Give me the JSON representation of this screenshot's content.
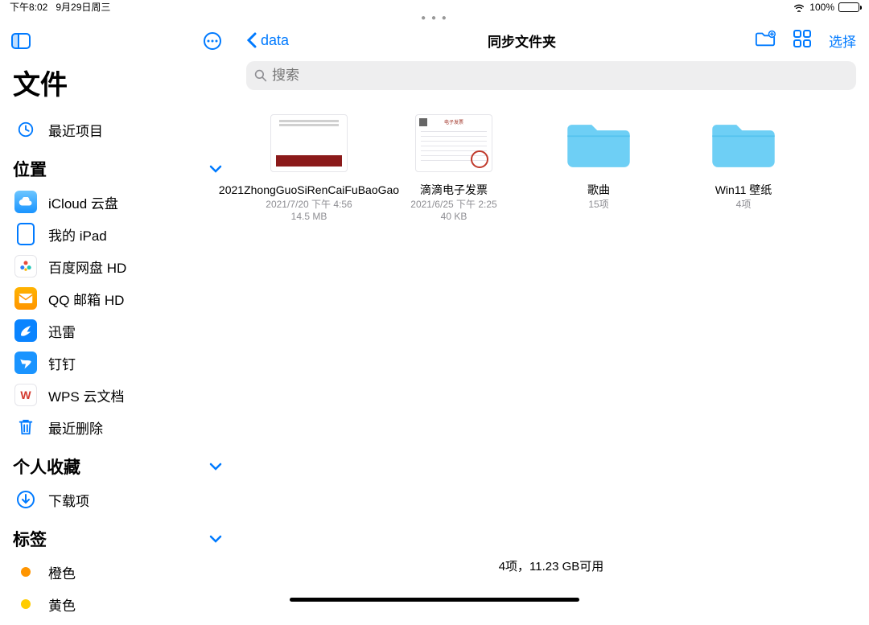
{
  "status": {
    "time": "下午8:02",
    "date": "9月29日周三",
    "battery_pct": "100%"
  },
  "sidebar": {
    "title": "文件",
    "recent": "最近项目",
    "locations_header": "位置",
    "loc": {
      "icloud": "iCloud 云盘",
      "ipad": "我的 iPad",
      "baidu": "百度网盘 HD",
      "qq": "QQ 邮箱 HD",
      "xunlei": "迅雷",
      "dingding": "钉钉",
      "wps": "WPS 云文档",
      "trash": "最近删除"
    },
    "favorites_header": "个人收藏",
    "downloads": "下载项",
    "tags_header": "标签",
    "tag_orange": "橙色",
    "tag_yellow": "黄色"
  },
  "toolbar": {
    "back_label": "data",
    "title": "同步文件夹",
    "select": "选择"
  },
  "search": {
    "placeholder": "搜索"
  },
  "items": [
    {
      "name": "2021ZhongGuoSiRenCaiFuBaoGao",
      "meta1": "2021/7/20 下午 4:56",
      "meta2": "14.5 MB"
    },
    {
      "name": "滴滴电子发票",
      "meta1": "2021/6/25 下午 2:25",
      "meta2": "40 KB"
    },
    {
      "name": "歌曲",
      "meta1": "15项",
      "meta2": ""
    },
    {
      "name": "Win11 壁纸",
      "meta1": "4项",
      "meta2": ""
    }
  ],
  "footer": "4项，11.23 GB可用"
}
